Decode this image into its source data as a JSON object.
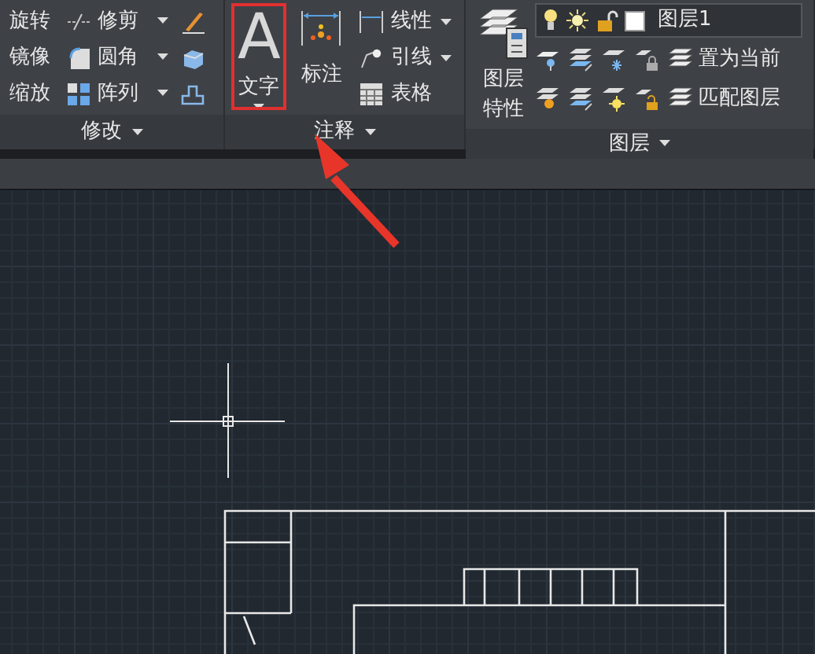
{
  "ribbon": {
    "panels": [
      {
        "kind": "modify",
        "title": "修改",
        "rows": [
          [
            {
              "label": "旋转"
            },
            {
              "label": "修剪",
              "kind": "trim",
              "dropdown": true
            },
            {
              "kind": "brush"
            }
          ],
          [
            {
              "label": "镜像"
            },
            {
              "label": "圆角",
              "kind": "fillet",
              "dropdown": true
            },
            {
              "kind": "box"
            }
          ],
          [
            {
              "label": "缩放"
            },
            {
              "label": "阵列",
              "kind": "array",
              "dropdown": true
            },
            {
              "kind": "outline"
            }
          ]
        ]
      },
      {
        "kind": "annotate",
        "title": "注释",
        "large": [
          {
            "label": "文字",
            "glyph": "A",
            "dropdown": true,
            "highlighted": true
          },
          {
            "label": "标注",
            "kind": "dimension",
            "dropdown": false
          }
        ],
        "small": [
          {
            "label": "线性",
            "kind": "linear",
            "dropdown": true
          },
          {
            "label": "引线",
            "kind": "leader",
            "dropdown": true
          },
          {
            "label": "表格",
            "kind": "table",
            "dropdown": false
          }
        ]
      },
      {
        "kind": "layers",
        "title": "图层",
        "large": {
          "label": "图层特性"
        },
        "layer_selector": {
          "name": "图层1"
        },
        "rows": [
          {
            "tools": [
              {
                "kind": "pin"
              },
              {
                "kind": "down"
              },
              {
                "kind": "snow"
              },
              {
                "kind": "lock"
              }
            ],
            "label": "置为当前"
          },
          {
            "tools": [
              {
                "kind": "bulb"
              },
              {
                "kind": "up"
              },
              {
                "kind": "sun"
              },
              {
                "kind": "unlock"
              }
            ],
            "label": "匹配图层"
          }
        ]
      }
    ]
  }
}
